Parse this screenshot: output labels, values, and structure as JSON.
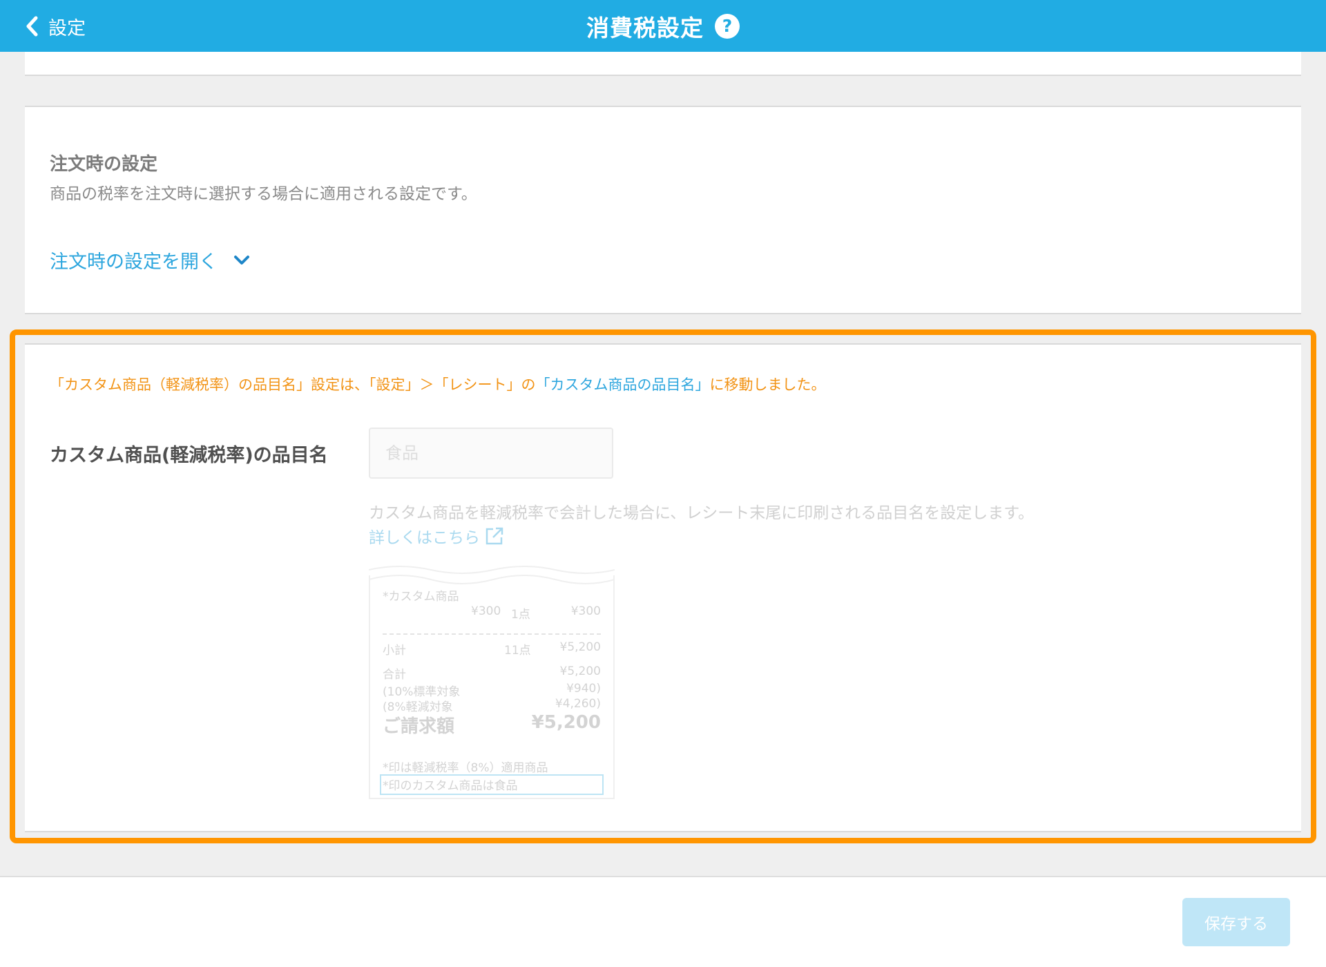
{
  "header": {
    "back_label": "設定",
    "title": "消費税設定",
    "help_symbol": "?"
  },
  "order_settings": {
    "title": "注文時の設定",
    "description": "商品の税率を注文時に選択する場合に適用される設定です。",
    "expand_label": "注文時の設定を開く"
  },
  "custom_item": {
    "notice_part1": "「カスタム商品（軽減税率）の品目名」設定は、「設定」＞「レシート」の",
    "notice_link": "「カスタム商品の品目名」",
    "notice_part2": "に移動しました。",
    "label": "カスタム商品(軽減税率)の品目名",
    "input_placeholder": "食品",
    "help_text": "カスタム商品を軽減税率で会計した場合に、レシート末尾に印刷される品目名を設定します。",
    "details_link": "詳しくはこちら"
  },
  "receipt": {
    "item_name": "*カスタム商品",
    "item_price": "¥300",
    "item_qty": "1点",
    "item_total": "¥300",
    "subtotal_label": "小計",
    "subtotal_qty": "11点",
    "subtotal_value": "¥5,200",
    "total_label": "合計",
    "total_value": "¥5,200",
    "std_label": "(10%標準対象",
    "std_value": "¥940)",
    "reduced_label": "(8%軽減対象",
    "reduced_value": "¥4,260)",
    "billing_label": "ご請求額",
    "billing_value": "¥5,200",
    "note1": "*印は軽減税率（8%）適用商品",
    "note2": "*印のカスタム商品は食品"
  },
  "footer": {
    "save_label": "保存する"
  },
  "colors": {
    "header_bg": "#21ace3",
    "accent_orange": "#ff9500",
    "link_blue": "#2da6de"
  }
}
